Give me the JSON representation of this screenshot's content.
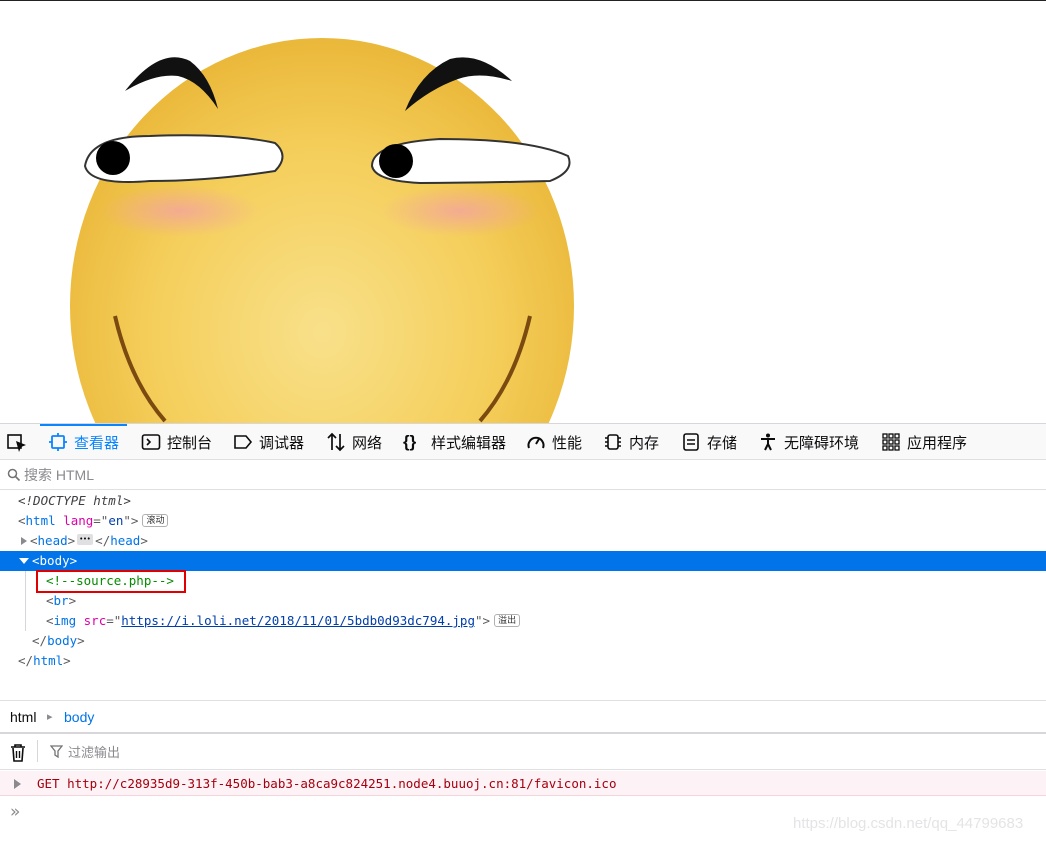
{
  "devtools": {
    "tabs": [
      {
        "label": "查看器",
        "icon": "inspector-icon",
        "active": true
      },
      {
        "label": "控制台",
        "icon": "console-icon"
      },
      {
        "label": "调试器",
        "icon": "debugger-icon"
      },
      {
        "label": "网络",
        "icon": "network-icon"
      },
      {
        "label": "样式编辑器",
        "icon": "style-editor-icon"
      },
      {
        "label": "性能",
        "icon": "performance-icon"
      },
      {
        "label": "内存",
        "icon": "memory-icon"
      },
      {
        "label": "存储",
        "icon": "storage-icon"
      },
      {
        "label": "无障碍环境",
        "icon": "accessibility-icon"
      },
      {
        "label": "应用程序",
        "icon": "application-icon"
      }
    ],
    "accent_color": "#0a84ff"
  },
  "search": {
    "placeholder": "搜索 HTML"
  },
  "markup": {
    "doctype": "<!DOCTYPE html>",
    "html_open": {
      "tag": "html",
      "attr": "lang",
      "value": "en",
      "badge": "滚动"
    },
    "head": {
      "open": "head",
      "close": "head"
    },
    "body_open": "body",
    "comment": "<!--source.php-->",
    "br": "br",
    "img": {
      "tag": "img",
      "attr": "src",
      "value": "https://i.loli.net/2018/11/01/5bdb0d93dc794.jpg",
      "badge": "溢出"
    },
    "body_close": "body",
    "html_close": "html"
  },
  "breadcrumbs": [
    "html",
    "body"
  ],
  "console": {
    "filter_placeholder": "过滤输出",
    "messages": [
      {
        "method": "GET",
        "url": "http://c28935d9-313f-450b-bab3-a8ca9c824251.node4.buuoj.cn:81/favicon.ico"
      }
    ],
    "prompt": "»"
  },
  "watermark": "https://blog.csdn.net/qq_44799683"
}
